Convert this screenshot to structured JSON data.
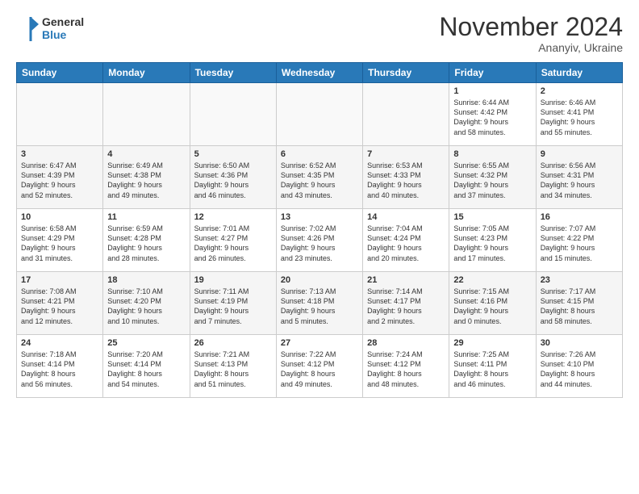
{
  "header": {
    "logo_general": "General",
    "logo_blue": "Blue",
    "month_title": "November 2024",
    "location": "Ananyiv, Ukraine"
  },
  "weekdays": [
    "Sunday",
    "Monday",
    "Tuesday",
    "Wednesday",
    "Thursday",
    "Friday",
    "Saturday"
  ],
  "weeks": [
    [
      {
        "day": "",
        "info": ""
      },
      {
        "day": "",
        "info": ""
      },
      {
        "day": "",
        "info": ""
      },
      {
        "day": "",
        "info": ""
      },
      {
        "day": "",
        "info": ""
      },
      {
        "day": "1",
        "info": "Sunrise: 6:44 AM\nSunset: 4:42 PM\nDaylight: 9 hours\nand 58 minutes."
      },
      {
        "day": "2",
        "info": "Sunrise: 6:46 AM\nSunset: 4:41 PM\nDaylight: 9 hours\nand 55 minutes."
      }
    ],
    [
      {
        "day": "3",
        "info": "Sunrise: 6:47 AM\nSunset: 4:39 PM\nDaylight: 9 hours\nand 52 minutes."
      },
      {
        "day": "4",
        "info": "Sunrise: 6:49 AM\nSunset: 4:38 PM\nDaylight: 9 hours\nand 49 minutes."
      },
      {
        "day": "5",
        "info": "Sunrise: 6:50 AM\nSunset: 4:36 PM\nDaylight: 9 hours\nand 46 minutes."
      },
      {
        "day": "6",
        "info": "Sunrise: 6:52 AM\nSunset: 4:35 PM\nDaylight: 9 hours\nand 43 minutes."
      },
      {
        "day": "7",
        "info": "Sunrise: 6:53 AM\nSunset: 4:33 PM\nDaylight: 9 hours\nand 40 minutes."
      },
      {
        "day": "8",
        "info": "Sunrise: 6:55 AM\nSunset: 4:32 PM\nDaylight: 9 hours\nand 37 minutes."
      },
      {
        "day": "9",
        "info": "Sunrise: 6:56 AM\nSunset: 4:31 PM\nDaylight: 9 hours\nand 34 minutes."
      }
    ],
    [
      {
        "day": "10",
        "info": "Sunrise: 6:58 AM\nSunset: 4:29 PM\nDaylight: 9 hours\nand 31 minutes."
      },
      {
        "day": "11",
        "info": "Sunrise: 6:59 AM\nSunset: 4:28 PM\nDaylight: 9 hours\nand 28 minutes."
      },
      {
        "day": "12",
        "info": "Sunrise: 7:01 AM\nSunset: 4:27 PM\nDaylight: 9 hours\nand 26 minutes."
      },
      {
        "day": "13",
        "info": "Sunrise: 7:02 AM\nSunset: 4:26 PM\nDaylight: 9 hours\nand 23 minutes."
      },
      {
        "day": "14",
        "info": "Sunrise: 7:04 AM\nSunset: 4:24 PM\nDaylight: 9 hours\nand 20 minutes."
      },
      {
        "day": "15",
        "info": "Sunrise: 7:05 AM\nSunset: 4:23 PM\nDaylight: 9 hours\nand 17 minutes."
      },
      {
        "day": "16",
        "info": "Sunrise: 7:07 AM\nSunset: 4:22 PM\nDaylight: 9 hours\nand 15 minutes."
      }
    ],
    [
      {
        "day": "17",
        "info": "Sunrise: 7:08 AM\nSunset: 4:21 PM\nDaylight: 9 hours\nand 12 minutes."
      },
      {
        "day": "18",
        "info": "Sunrise: 7:10 AM\nSunset: 4:20 PM\nDaylight: 9 hours\nand 10 minutes."
      },
      {
        "day": "19",
        "info": "Sunrise: 7:11 AM\nSunset: 4:19 PM\nDaylight: 9 hours\nand 7 minutes."
      },
      {
        "day": "20",
        "info": "Sunrise: 7:13 AM\nSunset: 4:18 PM\nDaylight: 9 hours\nand 5 minutes."
      },
      {
        "day": "21",
        "info": "Sunrise: 7:14 AM\nSunset: 4:17 PM\nDaylight: 9 hours\nand 2 minutes."
      },
      {
        "day": "22",
        "info": "Sunrise: 7:15 AM\nSunset: 4:16 PM\nDaylight: 9 hours\nand 0 minutes."
      },
      {
        "day": "23",
        "info": "Sunrise: 7:17 AM\nSunset: 4:15 PM\nDaylight: 8 hours\nand 58 minutes."
      }
    ],
    [
      {
        "day": "24",
        "info": "Sunrise: 7:18 AM\nSunset: 4:14 PM\nDaylight: 8 hours\nand 56 minutes."
      },
      {
        "day": "25",
        "info": "Sunrise: 7:20 AM\nSunset: 4:14 PM\nDaylight: 8 hours\nand 54 minutes."
      },
      {
        "day": "26",
        "info": "Sunrise: 7:21 AM\nSunset: 4:13 PM\nDaylight: 8 hours\nand 51 minutes."
      },
      {
        "day": "27",
        "info": "Sunrise: 7:22 AM\nSunset: 4:12 PM\nDaylight: 8 hours\nand 49 minutes."
      },
      {
        "day": "28",
        "info": "Sunrise: 7:24 AM\nSunset: 4:12 PM\nDaylight: 8 hours\nand 48 minutes."
      },
      {
        "day": "29",
        "info": "Sunrise: 7:25 AM\nSunset: 4:11 PM\nDaylight: 8 hours\nand 46 minutes."
      },
      {
        "day": "30",
        "info": "Sunrise: 7:26 AM\nSunset: 4:10 PM\nDaylight: 8 hours\nand 44 minutes."
      }
    ]
  ]
}
